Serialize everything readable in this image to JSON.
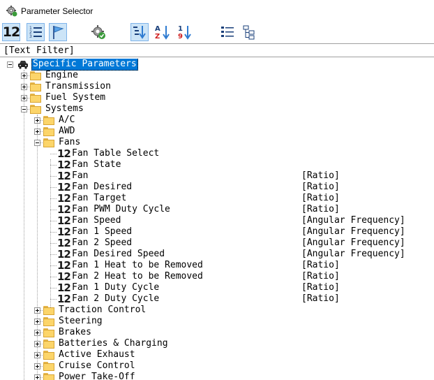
{
  "window": {
    "title": "Parameter Selector"
  },
  "toolbar": {
    "buttons": [
      {
        "icon": "numeric-12-icon",
        "active": true
      },
      {
        "icon": "numbered-list-icon",
        "active": true
      },
      {
        "icon": "flag-icon",
        "active": true
      },
      {
        "icon": "gear-check-icon",
        "active": false
      },
      {
        "icon": "sort-tree-icon",
        "active": true
      },
      {
        "icon": "sort-az-icon",
        "active": false
      },
      {
        "icon": "sort-19-icon",
        "active": false
      },
      {
        "icon": "expand-all-icon",
        "active": false
      },
      {
        "icon": "collapse-tree-icon",
        "active": false
      }
    ]
  },
  "filter": {
    "text": "[Text Filter]"
  },
  "tree": {
    "root": {
      "label": "Specific Parameters"
    },
    "groups": [
      "Engine",
      "Transmission",
      "Fuel System"
    ],
    "systems": {
      "label": "Systems",
      "ac": "A/C",
      "awd": "AWD",
      "fans": {
        "label": "Fans",
        "params": [
          {
            "icon_text": "12",
            "label": "Fan Table Select",
            "unit": ""
          },
          {
            "icon_text": "12",
            "label": "Fan State",
            "unit": ""
          },
          {
            "icon_text": "12",
            "label": "Fan",
            "unit": "[Ratio]"
          },
          {
            "icon_text": "12",
            "label": "Fan Desired",
            "unit": "[Ratio]"
          },
          {
            "icon_text": "12",
            "label": "Fan Target",
            "unit": "[Ratio]"
          },
          {
            "icon_text": "12",
            "label": "Fan PWM Duty Cycle",
            "unit": "[Ratio]"
          },
          {
            "icon_text": "12",
            "label": "Fan Speed",
            "unit": "[Angular Frequency]"
          },
          {
            "icon_text": "12",
            "label": "Fan 1 Speed",
            "unit": "[Angular Frequency]"
          },
          {
            "icon_text": "12",
            "label": "Fan 2 Speed",
            "unit": "[Angular Frequency]"
          },
          {
            "icon_text": "12",
            "label": "Fan Desired Speed",
            "unit": "[Angular Frequency]"
          },
          {
            "icon_text": "12",
            "label": "Fan 1 Heat to be Removed",
            "unit": "[Ratio]"
          },
          {
            "icon_text": "12",
            "label": "Fan 2 Heat to be Removed",
            "unit": "[Ratio]"
          },
          {
            "icon_text": "12",
            "label": "Fan 1 Duty Cycle",
            "unit": "[Ratio]"
          },
          {
            "icon_text": "12",
            "label": "Fan 2 Duty Cycle",
            "unit": "[Ratio]"
          }
        ]
      },
      "others": [
        "Traction Control",
        "Steering",
        "Brakes",
        "Batteries & Charging",
        "Active Exhaust",
        "Cruise Control",
        "Power Take-Off"
      ]
    }
  }
}
